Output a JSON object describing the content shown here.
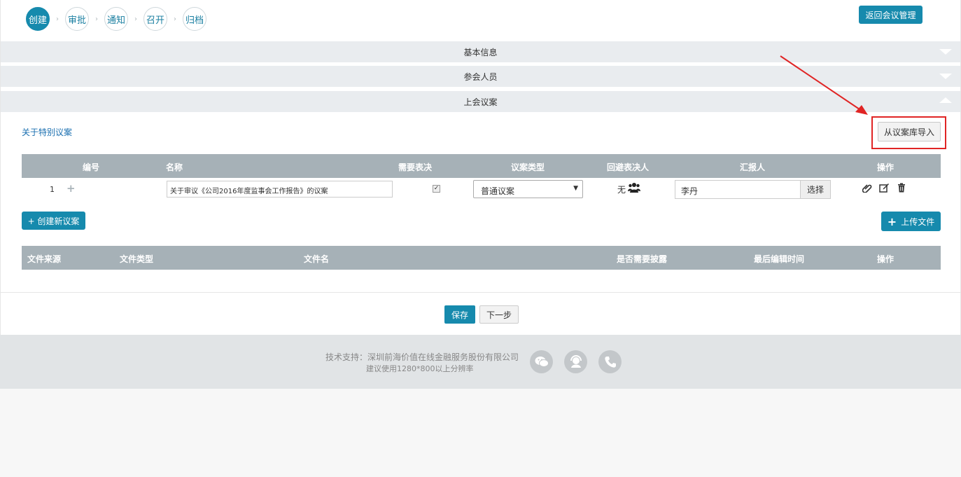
{
  "steps": [
    "创建",
    "审批",
    "通知",
    "召开",
    "归档"
  ],
  "return_button": "返回会议管理",
  "sections": {
    "basic": "基本信息",
    "participants": "参会人员",
    "motions": "上会议案"
  },
  "special_link": "关于特别议案",
  "import_button": "从议案库导入",
  "motions_table": {
    "headers": [
      "编号",
      "名称",
      "需要表决",
      "议案类型",
      "回避表决人",
      "汇报人",
      "操作"
    ],
    "row": {
      "num": "1",
      "name": "关于审议《公司2016年度监事会工作报告》的议案",
      "needs_vote": true,
      "type": "普通议案",
      "recusal": "无",
      "reporter": "李丹",
      "select_label": "选择"
    }
  },
  "create_button": "+ 创建新议案",
  "upload_button": "上传文件",
  "files_table": {
    "headers": [
      "文件来源",
      "文件类型",
      "文件名",
      "是否需要披露",
      "最后编辑时间",
      "操作"
    ]
  },
  "save_button": "保存",
  "next_button": "下一步",
  "footer": {
    "support": "技术支持：深圳前海价值在线金融服务股份有限公司",
    "resolution": "建议使用1280*800以上分辨率"
  },
  "colors": {
    "primary": "#168aad",
    "header_bg": "#a6b1b7",
    "highlight": "#e02424"
  }
}
